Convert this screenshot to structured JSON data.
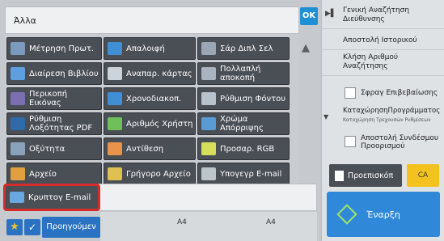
{
  "header": {
    "title": "Άλλα",
    "ok_label": "OK"
  },
  "functions": [
    {
      "label": "Μέτρηση Πρωτ.",
      "icon": "counter-icon"
    },
    {
      "label": "Απαλοιφή",
      "icon": "erase-icon"
    },
    {
      "label": "Σάρ Διπλ Σελ",
      "icon": "dual-page-icon"
    },
    {
      "label": "Διαίρεση Βιβλίου",
      "icon": "book-divide-icon"
    },
    {
      "label": "Αναπαρ. κάρτας",
      "icon": "card-icon"
    },
    {
      "label": "Πολλαπλή αποκοπή",
      "icon": "multi-crop-icon"
    },
    {
      "label": "Περικοπή Εικόνας",
      "icon": "image-crop-icon"
    },
    {
      "label": "Χρονοδιακοπ.",
      "icon": "timer-icon"
    },
    {
      "label": "Ρύθμιση Φόντου",
      "icon": "background-icon"
    },
    {
      "label": "Ρύθμιση Λοξότητας PDF",
      "icon": "pdf-skew-icon"
    },
    {
      "label": "Αριθμός Χρήστη",
      "icon": "user-number-icon"
    },
    {
      "label": "Χρώμα Απόρριψης",
      "icon": "color-drop-icon"
    },
    {
      "label": "Οξύτητα",
      "icon": "sharpness-icon"
    },
    {
      "label": "Αντίθεση",
      "icon": "contrast-icon"
    },
    {
      "label": "Προσαρ. RGB",
      "icon": "rgb-icon"
    },
    {
      "label": "Αρχείο",
      "icon": "file-icon"
    },
    {
      "label": "Γρήγορο Αρχείο",
      "icon": "quick-file-icon"
    },
    {
      "label": "Υπογεγρ E-mail",
      "icon": "signed-mail-icon"
    }
  ],
  "highlighted": {
    "label": "Κρυπτογ E-mail",
    "icon": "encrypted-mail-icon"
  },
  "status": {
    "paper_left": "A4",
    "paper_right": "A4"
  },
  "bottom": {
    "prev_label": "Προηγούμεν"
  },
  "right": {
    "items": [
      "Γενική Αναζήτηση Διεύθυνσης",
      "Αποστολή Ιστορικού",
      "Κλήση Αριθμού Αναζήτησης"
    ],
    "stamp_label": "Σφραγ Επιβεβαίωσης",
    "program_label": "ΚαταχώρησηΠρογράμματος",
    "program_sub": "Καταχώρηση Τρεχουσών Ρυθμίσεων",
    "link_label": "Αποστολή Συνδέσμου Προορισμού",
    "preview_label": "Προεπισκόπ",
    "ca_label": "CA",
    "start_label": "Έναρξη"
  },
  "colors": {
    "accent": "#2f89d8",
    "highlight": "#d52b2b",
    "ca": "#f3c21e"
  }
}
